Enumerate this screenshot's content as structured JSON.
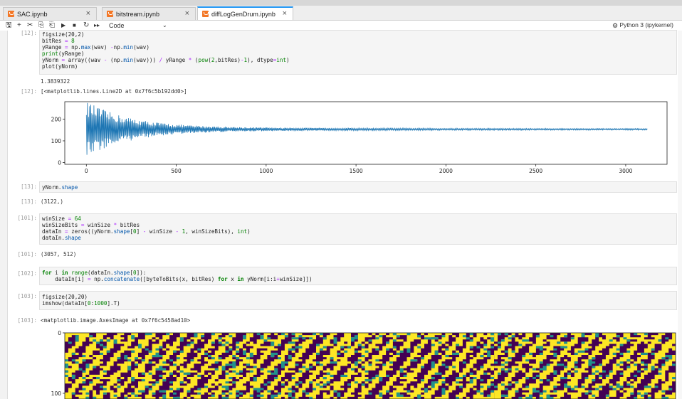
{
  "tabs": [
    {
      "label": "SAC.ipynb",
      "close": "×"
    },
    {
      "label": "bitstream.ipynb",
      "close": "×"
    },
    {
      "label": "diffLogGenDrum.ipynb",
      "close": "×"
    }
  ],
  "toolbar": {
    "cell_type": "Code",
    "kernel": "Python 3 (ipykernel)"
  },
  "cells": {
    "c12_prompt": "[12]:",
    "c12_line0": "figsize(20,2)",
    "c12_out_prompt": "[12]:",
    "c12_stdout": "1.3839322",
    "c12_result": "[<matplotlib.lines.Line2D at 0x7f6c5b192dd0>]",
    "c13_prompt": "[13]:",
    "c13_out_prompt": "[13]:",
    "c13_result": "(3122,)",
    "c101_prompt": "[101]:",
    "c101_out_prompt": "[101]:",
    "c101_result": "(3057, 512)",
    "c102_prompt": "[102]:",
    "c103_prompt": "[103]:",
    "c103_line0": "figsize(20,20)",
    "c103_out_prompt": "[103]:",
    "c103_result": "<matplotlib.image.AxesImage at 0x7f6c5458ad10>"
  },
  "chart_data": [
    {
      "type": "line",
      "x_ticks": [
        0,
        500,
        1000,
        1500,
        2000,
        2500,
        3000
      ],
      "y_ticks": [
        0,
        100,
        200
      ],
      "xlim": [
        -120,
        3230
      ],
      "ylim": [
        -8,
        280
      ],
      "n_points": 3122,
      "center": 153,
      "peak_amplitude": 120,
      "series_color": "#1f77b4"
    },
    {
      "type": "heatmap",
      "y_ticks": [
        0,
        100
      ],
      "colormap": "viridis"
    }
  ]
}
